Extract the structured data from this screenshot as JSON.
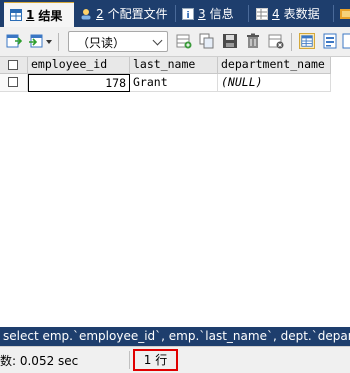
{
  "tabs": [
    {
      "num": "1",
      "label": "结果",
      "icon": "result-grid-icon",
      "active": true
    },
    {
      "num": "2",
      "label": "个配置文件",
      "icon": "profile-icon",
      "active": false
    },
    {
      "num": "3",
      "label": "信息",
      "icon": "info-icon",
      "active": false
    },
    {
      "num": "4",
      "label": "表数据",
      "icon": "table-data-icon",
      "active": false
    }
  ],
  "toolbar": {
    "mode": "（只读）"
  },
  "grid": {
    "columns": [
      "employee_id",
      "last_name",
      "department_name"
    ],
    "rows": [
      {
        "employee_id": "178",
        "last_name": "Grant",
        "department_name": "(NULL)"
      }
    ]
  },
  "sql": "select emp.`employee_id`, emp.`last_name`, dept.`departm",
  "status": {
    "time": "数: 0.052 sec",
    "rows": "1 行"
  },
  "colors": {
    "tabbar_bg": "#1e3e6d",
    "highlight_box": "#e00000"
  }
}
